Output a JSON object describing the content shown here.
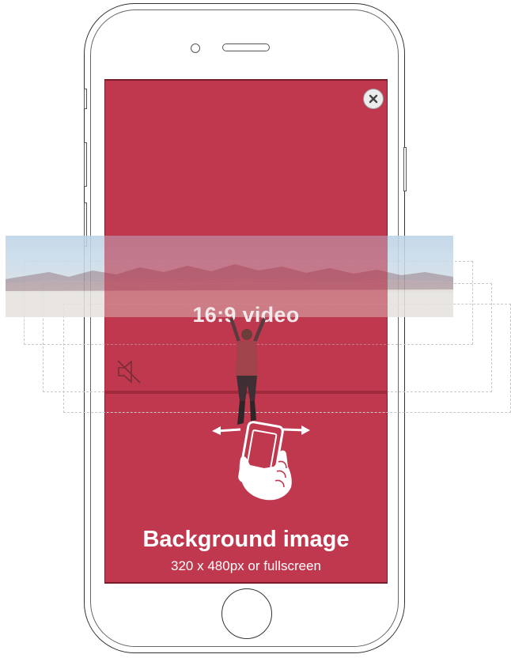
{
  "video": {
    "label": "16:9 video",
    "aspect_ratio": "16:9"
  },
  "background_image": {
    "title": "Background image",
    "subtitle": "320 x 480px or fullscreen"
  },
  "icons": {
    "close": "close-icon",
    "mute": "speaker-muted-icon",
    "swipe": "hand-swipe-icon",
    "person": "person-arms-raised-icon"
  },
  "colors": {
    "background_image": "#c0384e",
    "frame_border": "#7a1d2b",
    "video_sky": "#bcd3e7",
    "text_light": "#ffffff"
  }
}
